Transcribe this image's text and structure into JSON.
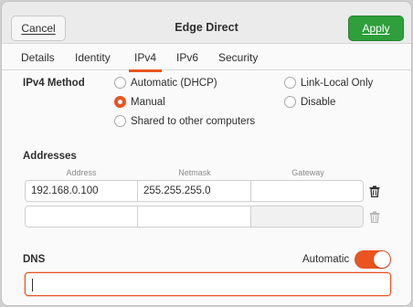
{
  "header": {
    "title": "Edge Direct",
    "cancel_label": "Cancel",
    "apply_label": "Apply"
  },
  "tabs": [
    {
      "label": "Details",
      "active": false
    },
    {
      "label": "Identity",
      "active": false
    },
    {
      "label": "IPv4",
      "active": true
    },
    {
      "label": "IPv6",
      "active": false
    },
    {
      "label": "Security",
      "active": false
    }
  ],
  "ipv4": {
    "method_label": "IPv4 Method",
    "methods": [
      {
        "label": "Automatic (DHCP)",
        "checked": false
      },
      {
        "label": "Link-Local Only",
        "checked": false
      },
      {
        "label": "Manual",
        "checked": true
      },
      {
        "label": "Disable",
        "checked": false
      },
      {
        "label": "Shared to other computers",
        "checked": false
      }
    ]
  },
  "addresses": {
    "label": "Addresses",
    "columns": [
      "Address",
      "Netmask",
      "Gateway"
    ],
    "rows": [
      [
        "192.168.0.100",
        "255.255.255.0",
        ""
      ],
      [
        "",
        "",
        ""
      ]
    ]
  },
  "dns": {
    "label": "DNS",
    "automatic_label": "Automatic",
    "automatic_on": true,
    "value": ""
  },
  "colors": {
    "accent": "#e95420",
    "apply": "#2e9f3a"
  }
}
